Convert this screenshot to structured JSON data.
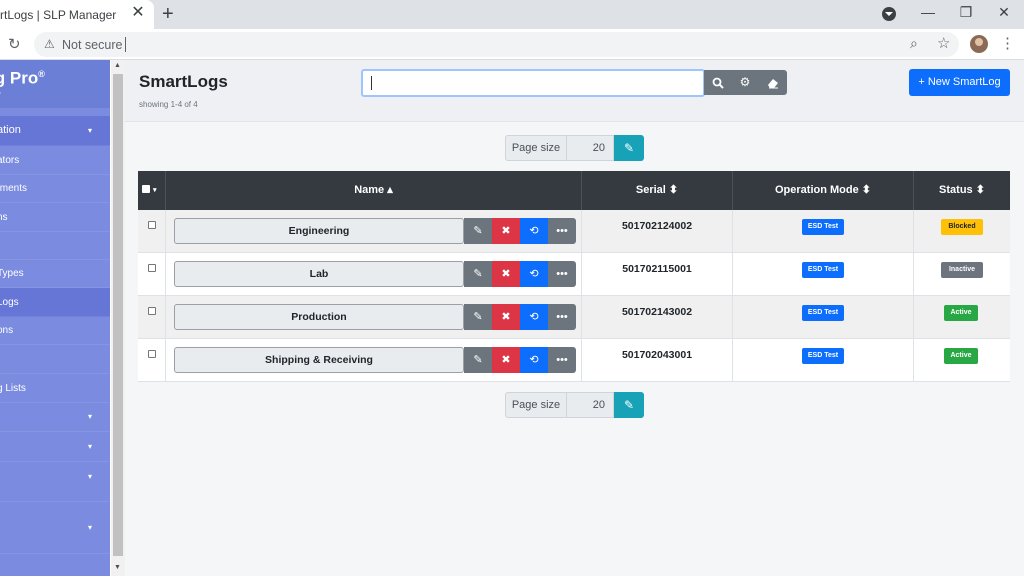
{
  "browser": {
    "tab_title": "rtLogs | SLP Manager",
    "tab_close": "✕",
    "new_tab": "+",
    "not_secure": "Not secure",
    "controls": {
      "minimize": "—",
      "restore": "❐",
      "close": "✕"
    }
  },
  "sidebar": {
    "brand_line1": "Log Pro",
    "brand_reg": "®",
    "brand_line2": "ger",
    "items": [
      {
        "label": "ation",
        "chevron": "▾"
      },
      {
        "label": "ators"
      },
      {
        "label": "tments"
      },
      {
        "label": "ns"
      },
      {
        "label": ""
      },
      {
        "label": " Types"
      },
      {
        "label": "Logs"
      },
      {
        "label": "ons"
      },
      {
        "label": ""
      },
      {
        "label": "g Lists"
      },
      {
        "label": "",
        "chevron": "▾"
      },
      {
        "label": "",
        "chevron": "▾"
      },
      {
        "label": "",
        "chevron": "▾"
      },
      {
        "label": "",
        "chevron": "▾"
      }
    ]
  },
  "header": {
    "title": "SmartLogs",
    "showing": "showing 1-4 of 4",
    "search_value": "",
    "new_button": "+ New SmartLog"
  },
  "page_size": {
    "label": "Page size",
    "value": "20"
  },
  "table": {
    "columns": {
      "name": "Name ▴",
      "serial": "Serial ⬍",
      "mode": "Operation Mode ⬍",
      "status": "Status ⬍"
    },
    "rows": [
      {
        "name": "Engineering",
        "serial": "501702124002",
        "mode": "ESD Test",
        "status": "Blocked",
        "status_color": "#ffc107",
        "status_text_color": "#212529"
      },
      {
        "name": "Lab",
        "serial": "501702115001",
        "mode": "ESD Test",
        "status": "Inactive",
        "status_color": "#6c757d",
        "status_text_color": "#ffffff"
      },
      {
        "name": "Production",
        "serial": "501702143002",
        "mode": "ESD Test",
        "status": "Active",
        "status_color": "#28a745",
        "status_text_color": "#ffffff"
      },
      {
        "name": "Shipping & Receiving",
        "serial": "501702043001",
        "mode": "ESD Test",
        "status": "Active",
        "status_color": "#28a745",
        "status_text_color": "#ffffff"
      }
    ]
  },
  "icons": {
    "search": "search-icon",
    "settings": "gear-icon",
    "eraser": "eraser-icon",
    "edit": "edit-icon",
    "delete": "close-icon",
    "history": "history-icon",
    "more": "more-icon"
  },
  "colors": {
    "sidebar": "#7b8ce0",
    "primary": "#0d6efd",
    "danger": "#dc3545",
    "dark": "#343a40",
    "info": "#17a2b8",
    "secondary": "#6c757d"
  }
}
